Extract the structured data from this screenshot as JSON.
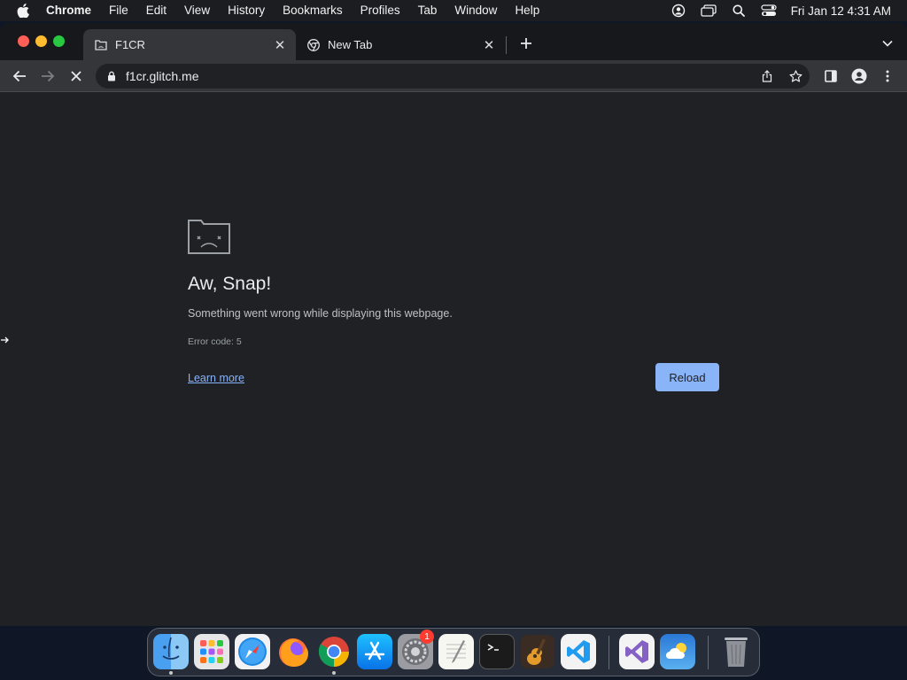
{
  "menubar": {
    "app_name": "Chrome",
    "items": [
      "File",
      "Edit",
      "View",
      "History",
      "Bookmarks",
      "Profiles",
      "Tab",
      "Window",
      "Help"
    ],
    "clock": "Fri Jan 12  4:31 AM",
    "status_icons": [
      "user-account-icon",
      "screen-mirroring-icon",
      "spotlight-search-icon",
      "control-center-icon"
    ]
  },
  "browser": {
    "tabs": [
      {
        "title": "F1CR",
        "active": true,
        "favicon": "sad-page-favicon"
      },
      {
        "title": "New Tab",
        "active": false,
        "favicon": "chrome-favicon"
      }
    ],
    "url": "f1cr.glitch.me"
  },
  "error_page": {
    "heading": "Aw, Snap!",
    "message": "Something went wrong while displaying this webpage.",
    "error_code": "Error code: 5",
    "learn_more": "Learn more",
    "reload": "Reload"
  },
  "dock": {
    "apps": [
      "Finder",
      "Launchpad",
      "Safari",
      "Firefox",
      "Google Chrome",
      "App Store",
      "System Preferences",
      "TextEdit",
      "Terminal",
      "GarageBand",
      "Visual Studio Code",
      "Visual Studio",
      "Weather",
      "Trash"
    ],
    "system_preferences_badge": "1"
  },
  "colors": {
    "accent": "#8ab4f8",
    "page_background": "#202124",
    "toolbar": "#35363a"
  }
}
